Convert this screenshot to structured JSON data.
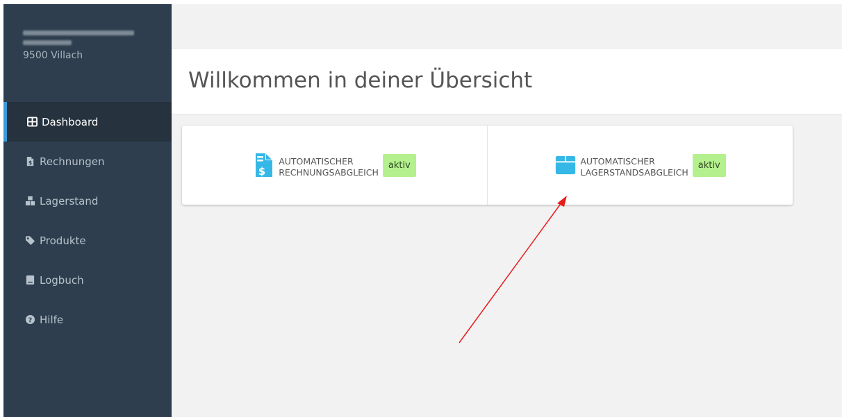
{
  "sidebar": {
    "org_line1": "████████████",
    "org_line2": "█████",
    "org_city": "9500 Villach",
    "items": [
      {
        "label": "Dashboard",
        "icon": "table-icon",
        "active": true
      },
      {
        "label": "Rechnungen",
        "icon": "invoice-icon",
        "active": false
      },
      {
        "label": "Lagerstand",
        "icon": "cubes-icon",
        "active": false
      },
      {
        "label": "Produkte",
        "icon": "tag-icon",
        "active": false
      },
      {
        "label": "Logbuch",
        "icon": "book-icon",
        "active": false
      },
      {
        "label": "Hilfe",
        "icon": "question-circle-icon",
        "active": false
      }
    ]
  },
  "header": {
    "title": "Willkommen in deiner Übersicht"
  },
  "cards": [
    {
      "line1": "AUTOMATISCHER",
      "line2": "RECHNUNGSABGLEICH",
      "status": "aktiv",
      "icon": "invoice-dollar-icon"
    },
    {
      "line1": "AUTOMATISCHER",
      "line2": "LAGERSTANDSABGLEICH",
      "status": "aktiv",
      "icon": "box-icon"
    }
  ],
  "colors": {
    "sidebar_bg": "#2e3e4e",
    "sidebar_active_bg": "#26323e",
    "accent_icon": "#35b8e6",
    "badge_bg": "#b5f08e",
    "annotation_arrow": "#e81c1c"
  }
}
